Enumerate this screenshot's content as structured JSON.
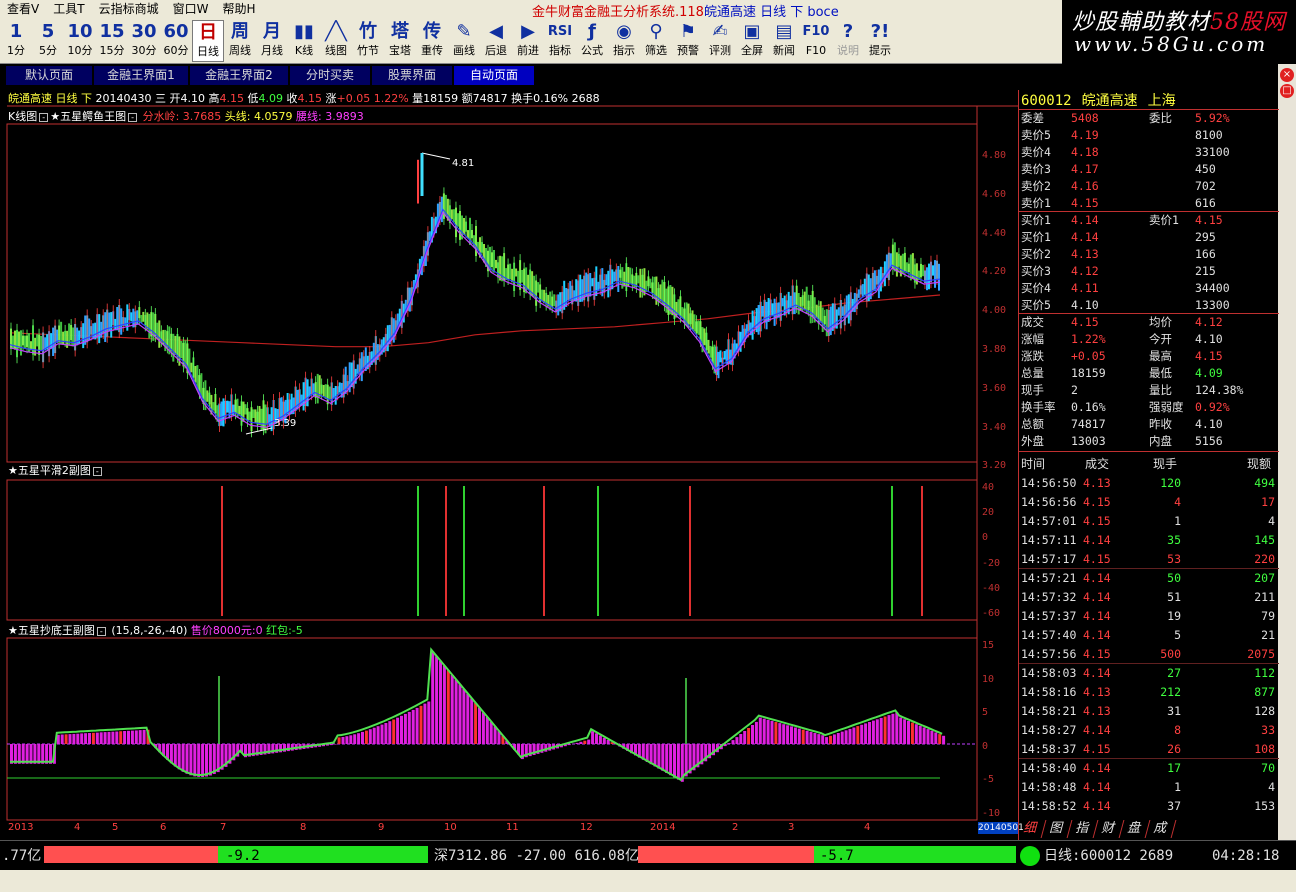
{
  "menu": [
    "查看V",
    "工具T",
    "云指标商城",
    "窗口W",
    "帮助H"
  ],
  "app_title": "金牛财富金融王分析系统.118",
  "app_title_stock": "皖通高速 日线 下 boce",
  "logo": {
    "line1a": "炒股輔助教材",
    "line1b": "58股网",
    "line2": "www.58Gu.com"
  },
  "toolbar": [
    {
      "icon": "1",
      "label": "1分"
    },
    {
      "icon": "5",
      "label": "5分"
    },
    {
      "icon": "10",
      "label": "10分"
    },
    {
      "icon": "15",
      "label": "15分"
    },
    {
      "icon": "30",
      "label": "30分"
    },
    {
      "icon": "60",
      "label": "60分"
    },
    {
      "icon": "日",
      "label": "日线",
      "active": true
    },
    {
      "icon": "周",
      "label": "周线"
    },
    {
      "icon": "月",
      "label": "月线"
    },
    {
      "icon": "▮▮",
      "label": "K线"
    },
    {
      "icon": "╱╲",
      "label": "线图"
    },
    {
      "icon": "竹",
      "label": "竹节"
    },
    {
      "icon": "塔",
      "label": "宝塔"
    },
    {
      "icon": "传",
      "label": "重传"
    },
    {
      "icon": "✎",
      "label": "画线"
    },
    {
      "icon": "◀",
      "label": "后退"
    },
    {
      "icon": "▶",
      "label": "前进"
    },
    {
      "icon": "RSI",
      "label": "指标"
    },
    {
      "icon": "ƒ",
      "label": "公式"
    },
    {
      "icon": "◉",
      "label": "指示"
    },
    {
      "icon": "⚲",
      "label": "筛选"
    },
    {
      "icon": "⚑",
      "label": "预警"
    },
    {
      "icon": "✍",
      "label": "评测"
    },
    {
      "icon": "▣",
      "label": "全屏"
    },
    {
      "icon": "▤",
      "label": "新闻"
    },
    {
      "icon": "F10",
      "label": "F10"
    },
    {
      "icon": "?",
      "label": "说明",
      "disabled": true
    },
    {
      "icon": "?!",
      "label": "提示"
    }
  ],
  "page_tabs": [
    "默认页面",
    "金融王界面1",
    "金融王界面2",
    "分时买卖",
    "股票界面",
    "自动页面"
  ],
  "active_tab": 5,
  "stock_header": {
    "name": "皖通高速",
    "period": "日线",
    "dir": "下",
    "date": "20140430",
    "weekday": "三",
    "open_label": "开",
    "open": "4.10",
    "high_label": "高",
    "high": "4.15",
    "low_label": "低",
    "low": "4.09",
    "close_label": "收",
    "close": "4.15",
    "chg_label": "涨",
    "chg": "+0.05",
    "pct": "1.22%",
    "vol_label": "量",
    "vol": "18159",
    "amt_label": "额",
    "amt": "74817",
    "turn_label": "换手",
    "turn": "0.16%",
    "extra": "2688"
  },
  "main_panel": {
    "title_k": "K线图",
    "title": "★五星鳄鱼王图",
    "l1": "分水岭: 3.7685",
    "l2": "头线: 4.0579",
    "l3": "腰线: 3.9893",
    "peak_label": "4.81",
    "low_label": "3.39"
  },
  "main_yaxis": [
    "4.80",
    "4.60",
    "4.40",
    "4.20",
    "4.00",
    "3.80",
    "3.60",
    "3.40",
    "3.20"
  ],
  "sub1": {
    "title": "★五星平滑2副图",
    "yaxis": [
      "40",
      "20",
      "0",
      "-20",
      "-40",
      "-60"
    ]
  },
  "sub2": {
    "title": "★五星抄底王副图",
    "params": "(15,8,-26,-40)",
    "price": "售价8000元:0",
    "hongbao": "红包:-5",
    "yaxis": [
      "15",
      "10",
      "5",
      "0",
      "-5",
      "-10"
    ]
  },
  "xaxis": [
    "2013",
    "4",
    "5",
    "6",
    "7",
    "8",
    "9",
    "10",
    "11",
    "12",
    "2014",
    "2",
    "3",
    "4"
  ],
  "cursor_date": "20140501",
  "quote": {
    "code": "600012",
    "name": "皖通高速",
    "market": "上海",
    "rows": [
      {
        "l": "委差",
        "v": "5408",
        "vc": "r",
        "l2": "委比",
        "v2": "5.92%",
        "v2c": "r"
      },
      {
        "l": "卖价5",
        "v": "4.19",
        "vc": "r",
        "v2": "8100",
        "v2c": "w"
      },
      {
        "l": "卖价4",
        "v": "4.18",
        "vc": "r",
        "v2": "33100",
        "v2c": "w"
      },
      {
        "l": "卖价3",
        "v": "4.17",
        "vc": "r",
        "v2": "450",
        "v2c": "w"
      },
      {
        "l": "卖价2",
        "v": "4.16",
        "vc": "r",
        "v2": "702",
        "v2c": "w"
      },
      {
        "l": "卖价1",
        "v": "4.15",
        "vc": "r",
        "v2": "616",
        "v2c": "w"
      },
      {
        "l": "买价1",
        "v": "4.14",
        "vc": "r",
        "l2": "卖价1",
        "v2": "4.15",
        "v2c": "r"
      },
      {
        "l": "买价1",
        "v": "4.14",
        "vc": "r",
        "v2": "295",
        "v2c": "w"
      },
      {
        "l": "买价2",
        "v": "4.13",
        "vc": "r",
        "v2": "166",
        "v2c": "w"
      },
      {
        "l": "买价3",
        "v": "4.12",
        "vc": "r",
        "v2": "215",
        "v2c": "w"
      },
      {
        "l": "买价4",
        "v": "4.11",
        "vc": "r",
        "v2": "34400",
        "v2c": "w"
      },
      {
        "l": "买价5",
        "v": "4.10",
        "vc": "w",
        "v2": "13300",
        "v2c": "w"
      },
      {
        "l": "成交",
        "v": "4.15",
        "vc": "r",
        "l2": "均价",
        "v2": "4.12",
        "v2c": "r"
      },
      {
        "l": "涨幅",
        "v": "1.22%",
        "vc": "r",
        "l2": "今开",
        "v2": "4.10",
        "v2c": "w"
      },
      {
        "l": "涨跌",
        "v": "+0.05",
        "vc": "r",
        "l2": "最高",
        "v2": "4.15",
        "v2c": "r"
      },
      {
        "l": "总量",
        "v": "18159",
        "vc": "w",
        "l2": "最低",
        "v2": "4.09",
        "v2c": "g"
      },
      {
        "l": "现手",
        "v": "2",
        "vc": "w",
        "l2": "量比",
        "v2": "124.38%",
        "v2c": "w"
      },
      {
        "l": "换手率",
        "v": "0.16%",
        "vc": "w",
        "l2": "强弱度",
        "v2": "0.92%",
        "v2c": "r"
      },
      {
        "l": "总额",
        "v": "74817",
        "vc": "w",
        "l2": "昨收",
        "v2": "4.10",
        "v2c": "w"
      },
      {
        "l": "外盘",
        "v": "13003",
        "vc": "w",
        "l2": "内盘",
        "v2": "5156",
        "v2c": "w"
      }
    ],
    "tick_header": [
      "时间",
      "成交",
      "现手",
      "现额"
    ],
    "ticks": [
      [
        "14:56:50",
        "4.13",
        "120",
        "494",
        "r",
        "g"
      ],
      [
        "14:56:56",
        "4.15",
        "4",
        "17",
        "r",
        "r"
      ],
      [
        "14:57:01",
        "4.15",
        "1",
        "4",
        "r",
        "w"
      ],
      [
        "14:57:11",
        "4.14",
        "35",
        "145",
        "r",
        "g"
      ],
      [
        "14:57:17",
        "4.15",
        "53",
        "220",
        "r",
        "r"
      ],
      [
        "14:57:21",
        "4.14",
        "50",
        "207",
        "r",
        "g"
      ],
      [
        "14:57:32",
        "4.14",
        "51",
        "211",
        "r",
        "w"
      ],
      [
        "14:57:37",
        "4.14",
        "19",
        "79",
        "r",
        "w"
      ],
      [
        "14:57:40",
        "4.14",
        "5",
        "21",
        "r",
        "w"
      ],
      [
        "14:57:56",
        "4.15",
        "500",
        "2075",
        "r",
        "r"
      ],
      [
        "14:58:03",
        "4.14",
        "27",
        "112",
        "r",
        "g"
      ],
      [
        "14:58:16",
        "4.13",
        "212",
        "877",
        "r",
        "g"
      ],
      [
        "14:58:21",
        "4.13",
        "31",
        "128",
        "r",
        "w"
      ],
      [
        "14:58:27",
        "4.14",
        "8",
        "33",
        "r",
        "r"
      ],
      [
        "14:58:37",
        "4.15",
        "26",
        "108",
        "r",
        "r"
      ],
      [
        "14:58:40",
        "4.14",
        "17",
        "70",
        "r",
        "g"
      ],
      [
        "14:58:48",
        "4.14",
        "1",
        "4",
        "r",
        "w"
      ],
      [
        "14:58:52",
        "4.14",
        "37",
        "153",
        "r",
        "w"
      ]
    ],
    "tabs": [
      "细",
      "图",
      "指",
      "财",
      "盘",
      "成"
    ]
  },
  "status": {
    "left_amt": ".77亿",
    "bar1_val": "-9.2",
    "index": "深7312.86",
    "index_chg": "-27.00",
    "index_amt": "616.08亿",
    "bar2_val": "-5.7",
    "bottom_stock": "日线:600012 2689",
    "time": "04:28:18"
  },
  "colors": {
    "up": "#ff4040",
    "down": "#40ff40",
    "accent": "#ffff40",
    "panel_border": "#c03030"
  },
  "chart_data": {
    "type": "candlestick",
    "title": "★五星鳄鱼王图",
    "x_ticks": [
      "2013",
      "4",
      "5",
      "6",
      "7",
      "8",
      "9",
      "10",
      "11",
      "12",
      "2014",
      "2",
      "3",
      "4"
    ],
    "ylim": [
      3.2,
      4.9
    ],
    "price_path": [
      3.82,
      3.8,
      3.79,
      3.84,
      3.83,
      3.86,
      3.9,
      3.92,
      3.94,
      3.88,
      3.8,
      3.72,
      3.55,
      3.45,
      3.48,
      3.43,
      3.42,
      3.46,
      3.52,
      3.58,
      3.54,
      3.6,
      3.7,
      3.78,
      3.88,
      4.05,
      4.3,
      4.5,
      4.4,
      4.32,
      4.2,
      4.15,
      4.12,
      4.05,
      4.0,
      4.05,
      4.08,
      4.1,
      4.14,
      4.12,
      4.08,
      4.02,
      3.95,
      3.85,
      3.7,
      3.75,
      3.88,
      3.95,
      3.98,
      4.02,
      3.98,
      3.9,
      3.96,
      4.05,
      4.1,
      4.22,
      4.18,
      4.14,
      4.15
    ],
    "ma_long": [
      3.85,
      3.84,
      3.83,
      3.82,
      3.81,
      3.8,
      3.79,
      3.78,
      3.78,
      3.8,
      3.84,
      3.86,
      3.87,
      3.88,
      3.9,
      3.92,
      3.95,
      3.97,
      4.0,
      4.02,
      4.04
    ]
  }
}
